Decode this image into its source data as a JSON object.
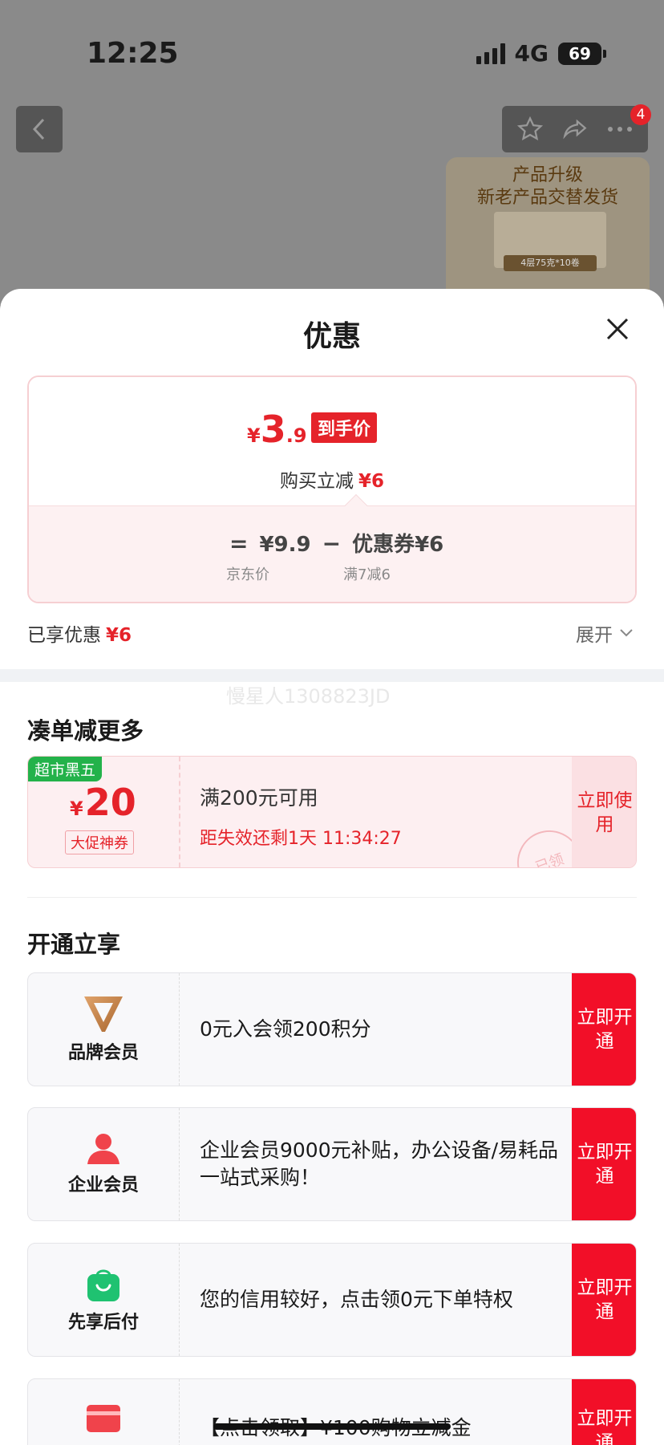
{
  "status_bar": {
    "time": "12:25",
    "network": "4G",
    "battery": "69"
  },
  "background_page": {
    "cart_badge": "4",
    "thumb_line1": "产品升级",
    "thumb_line2": "新老产品交替发货",
    "thumb_tag": "4层75克*10卷"
  },
  "sheet": {
    "title": "优惠",
    "price_card": {
      "currency": "¥",
      "final_int": "3",
      "final_dec": ".9",
      "final_tag": "到手价",
      "reduce_label": "购买立减",
      "reduce_value": "¥6",
      "equals": "=",
      "minus": "−",
      "base_price": "¥9.9",
      "base_label": "京东价",
      "coupon_item": "优惠券¥6",
      "coupon_rule": "满7减6"
    },
    "enjoyed_label": "已享优惠",
    "enjoyed_value": "¥6",
    "expand_label": "展开",
    "watermark": "慢星人1308823JD",
    "combine_title": "凑单减更多",
    "coupon": {
      "flag": "超市黑五",
      "symbol": "¥",
      "amount": "20",
      "type": "大促神券",
      "condition": "满200元可用",
      "expire": "距失效还剩1天 11:34:27",
      "button": "立即使用",
      "stamp": "已领"
    },
    "open_title": "开通立享",
    "members": [
      {
        "name": "品牌会员",
        "icon": "v-brand-icon",
        "desc": "0元入会领200积分",
        "button": "立即开通"
      },
      {
        "name": "企业会员",
        "icon": "person-icon",
        "desc": "企业会员9000元补贴，办公设备/易耗品一站式采购！",
        "button": "立即开通"
      },
      {
        "name": "先享后付",
        "icon": "shopping-bag-icon",
        "desc": "您的信用较好，点击领0元下单特权",
        "button": "立即开通"
      },
      {
        "name": "",
        "icon": "card-icon",
        "desc": "【点击领取】¥100购物立减金",
        "button": "立即开通"
      }
    ]
  },
  "colors": {
    "accent": "#e5232a",
    "button_red": "#f20f28",
    "green_flag": "#23b24a"
  }
}
